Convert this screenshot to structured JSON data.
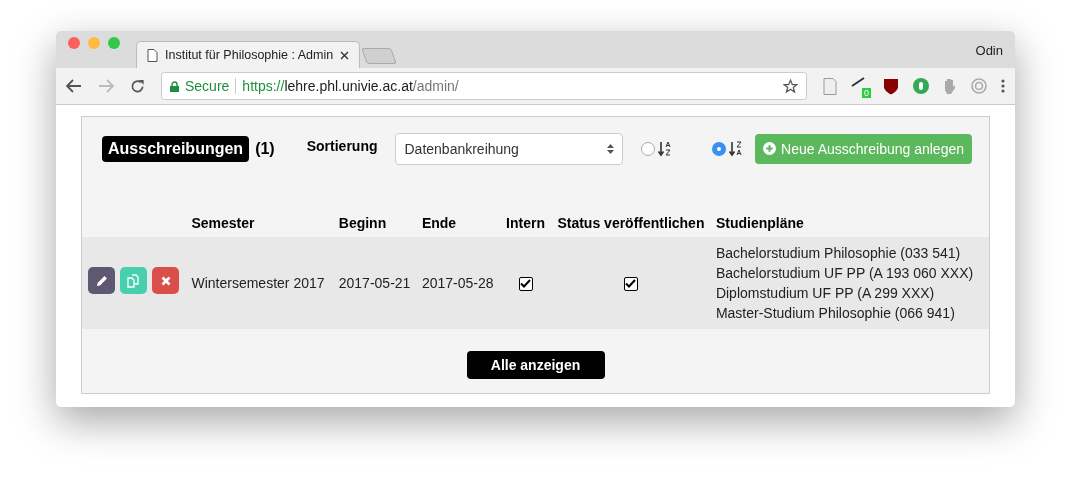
{
  "browser": {
    "tab_title": "Institut für Philosophie : Admin",
    "profile": "Odin",
    "secure_label": "Secure",
    "url_scheme": "https://",
    "url_host": "lehre.phl.univie.ac.at",
    "url_path": "/admin/",
    "extension_badge": "0"
  },
  "header": {
    "title": "Ausschreibungen",
    "count": "(1)",
    "sort_label": "Sortierung",
    "sort_value": "Datenbankreihung",
    "sort_orders": [
      {
        "kind": "asc",
        "selected": false
      },
      {
        "kind": "desc",
        "selected": true
      }
    ],
    "new_button": "Neue Ausschreibung anlegen"
  },
  "table": {
    "columns": [
      "Semester",
      "Beginn",
      "Ende",
      "Intern",
      "Status veröffentlichen",
      "Studienpläne"
    ],
    "rows": [
      {
        "semester": "Wintersemester 2017",
        "begin": "2017-05-21",
        "end": "2017-05-28",
        "intern": true,
        "published": true,
        "plans": [
          "Bachelorstudium Philosophie (033 541)",
          "Bachelorstudium UF PP (A 193 060 XXX)",
          "Diplomstudium UF PP (A 299 XXX)",
          "Master-Studium Philosophie (066 941)"
        ]
      }
    ]
  },
  "show_all_button": "Alle anzeigen"
}
